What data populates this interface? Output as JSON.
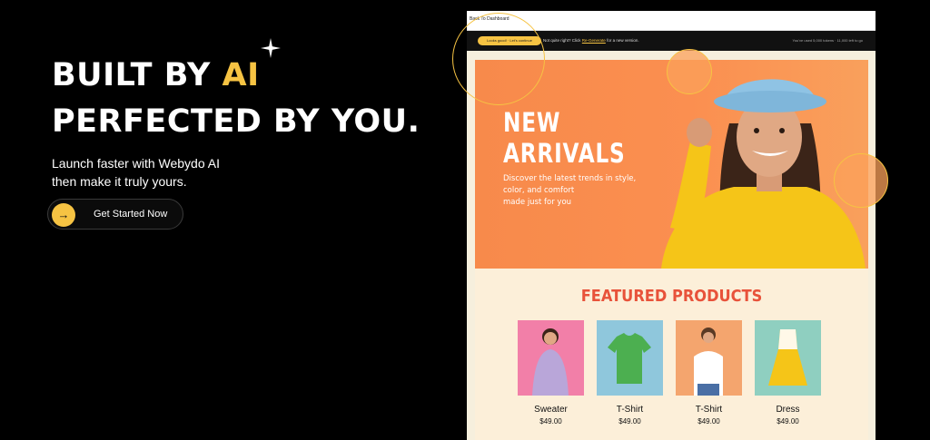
{
  "hero": {
    "line1_a": "BUILT BY ",
    "line1_b": "AI",
    "line2": "PERFECTED BY YOU.",
    "sub1": "Launch faster with Webydo AI",
    "sub2": "then make it truly yours.",
    "cta_label": "Get Started Now",
    "cta_icon": "→"
  },
  "editor": {
    "back_link": "Back To Dashboard",
    "pill": "Looks good! · Let's continue",
    "msg_a": "Not quite right? Click",
    "msg_link": "Re-Generate",
    "msg_b": "for a new version.",
    "tokens": "You've used 5,000 tokens · 11,000 left to go"
  },
  "site": {
    "banner_title_1": "NEW",
    "banner_title_2": "ARRIVALS",
    "banner_text_1": "Discover the latest trends in style,",
    "banner_text_2": "color, and comfort",
    "banner_text_3": "made just for you",
    "featured_title": "FEATURED PRODUCTS",
    "products": [
      {
        "name": "Sweater",
        "price": "$49.00",
        "bg": "#f27fa8"
      },
      {
        "name": "T-Shirt",
        "price": "$49.00",
        "bg": "#8fc7dc"
      },
      {
        "name": "T-Shirt",
        "price": "$49.00",
        "bg": "#f4a56e"
      },
      {
        "name": "Dress",
        "price": "$49.00",
        "bg": "#8fcfc0"
      }
    ]
  },
  "colors": {
    "accent": "#f6c343",
    "banner": "#f78a4b",
    "featured_title": "#e8523a"
  }
}
